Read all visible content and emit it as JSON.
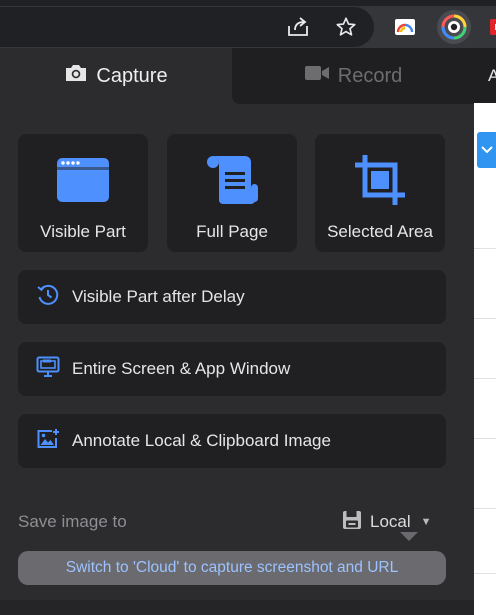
{
  "tabs": {
    "capture": {
      "label": "Capture",
      "icon": "camera-icon",
      "active": true
    },
    "record": {
      "label": "Record",
      "icon": "video-camera-icon",
      "active": false
    }
  },
  "capture_options": [
    {
      "label": "Visible Part",
      "icon": "browser-window-icon"
    },
    {
      "label": "Full Page",
      "icon": "scroll-page-icon"
    },
    {
      "label": "Selected Area",
      "icon": "crop-icon"
    }
  ],
  "more_options": [
    {
      "label": "Visible Part after Delay",
      "icon": "timer-icon"
    },
    {
      "label": "Entire Screen & App Window",
      "icon": "monitor-icon"
    },
    {
      "label": "Annotate Local & Clipboard Image",
      "icon": "image-add-icon"
    }
  ],
  "save": {
    "label": "Save image to",
    "selected": "Local",
    "icon": "floppy-disk-icon"
  },
  "cloud_banner": "Switch to 'Cloud' to capture screenshot and URL",
  "page_strip": {
    "letter": "A"
  },
  "colors": {
    "accent_blue": "#4d90fe",
    "panel_bg": "#2c2c2e",
    "card_bg": "#202022",
    "link_blue": "#9cc2ff"
  }
}
